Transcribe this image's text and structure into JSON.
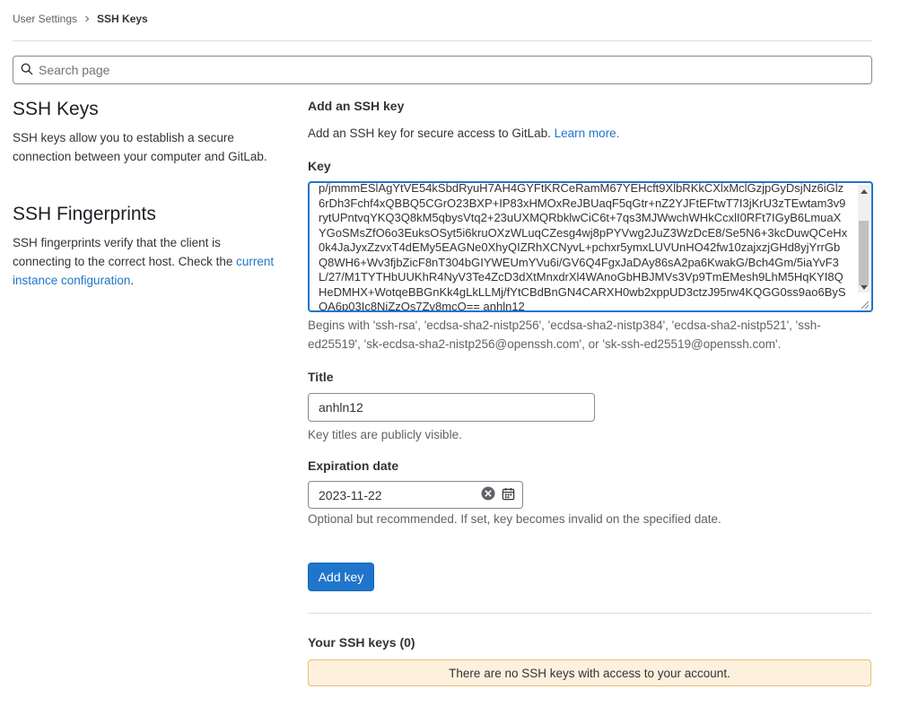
{
  "breadcrumb": {
    "parent": "User Settings",
    "current": "SSH Keys"
  },
  "search": {
    "placeholder": "Search page"
  },
  "ssh_keys_section": {
    "title": "SSH Keys",
    "description": "SSH keys allow you to establish a secure connection between your computer and GitLab."
  },
  "fingerprints_section": {
    "title": "SSH Fingerprints",
    "description": "SSH fingerprints verify that the client is connecting to the correct host. Check the",
    "link": "current instance configuration",
    "suffix": "."
  },
  "form": {
    "heading": "Add an SSH key",
    "intro": "Add an SSH key for secure access to GitLab.",
    "learn_more": "Learn more.",
    "key_label": "Key",
    "key_value": "p/jmmmESlAgYtVE54kSbdRyuH7AH4GYFtKRCeRamM67YEHcft9XlbRKkCXlxMclGzjpGyDsjNz6iGlz6rDh3Fchf4xQBBQ5CGrO23BXP+IP83xHMOxReJBUaqF5qGtr+nZ2YJFtEFtwT7I3jKrU3zTEwtam3v9rytUPntvqYKQ3Q8kM5qbysVtq2+23uUXMQRbklwCiC6t+7qs3MJWwchWHkCcxlI0RFt7IGyB6LmuaXYGoSMsZfO6o3EuksOSyt5i6kruOXzWLuqCZesg4wj8pPYVwg2JuZ3WzDcE8/Se5N6+3kcDuwQCeHx0k4JaJyxZzvxT4dEMy5EAGNe0XhyQIZRhXCNyvL+pchxr5ymxLUVUnHO42fw10zajxzjGHd8yjYrrGbQ8WH6+Wv3fjbZicF8nT304bGIYWEUmYVu6i/GV6Q4FgxJaDAy86sA2pa6KwakG/Bch4Gm/5iaYvF3L/27/M1TYTHbUUKhR4NyV3Te4ZcD3dXtMnxdrXl4WAnoGbHBJMVs3Vp9TmEMesh9LhM5HqKYI8QHeDMHX+WotqeBBGnKk4gLkLLMj/fYtCBdBnGN4CARXH0wb2xppUD3ctzJ95rw4KQGG0ss9ao6BySQA6p03Ic8NiZzOs7Zv8mcQ== anhln12",
    "key_help": "Begins with 'ssh-rsa', 'ecdsa-sha2-nistp256', 'ecdsa-sha2-nistp384', 'ecdsa-sha2-nistp521', 'ssh-ed25519', 'sk-ecdsa-sha2-nistp256@openssh.com', or 'sk-ssh-ed25519@openssh.com'.",
    "title_label": "Title",
    "title_value": "anhln12",
    "title_help": "Key titles are publicly visible.",
    "expiration_label": "Expiration date",
    "expiration_value": "2023-11-22",
    "expiration_help": "Optional but recommended. If set, key becomes invalid on the specified date.",
    "submit": "Add key"
  },
  "keys_list": {
    "heading": "Your SSH keys (0)",
    "empty_message": "There are no SSH keys with access to your account."
  },
  "icons": {
    "breadcrumb_separator": "chevron-right-icon",
    "search": "search-icon",
    "clear": "clear-icon",
    "calendar": "calendar-icon"
  },
  "colors": {
    "accent": "#1f75cb",
    "alert_bg": "#fdf1dd",
    "alert_border": "#e9be74"
  }
}
